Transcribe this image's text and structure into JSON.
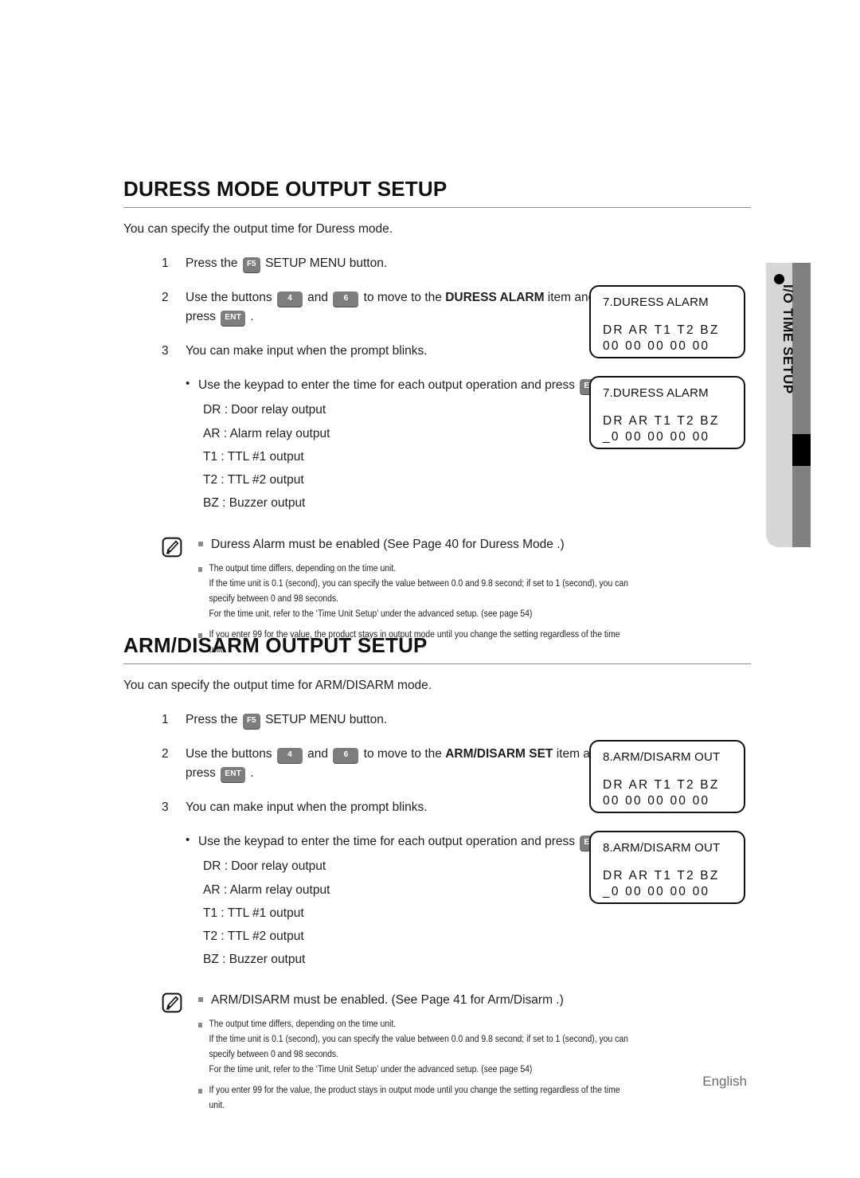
{
  "side_tab": {
    "label": "I/O TIME SETUP",
    "dot_icon": "bullet-dot-icon",
    "colors": {
      "light": "#d6d6d6",
      "dark": "#808080",
      "marker": "#000000"
    }
  },
  "sections": [
    {
      "id": "duress",
      "title": "DURESS MODE OUTPUT SETUP",
      "intro": "You can specify the output time for Duress mode.",
      "steps": [
        {
          "num": "1",
          "parts": [
            {
              "type": "text",
              "value": "Press the "
            },
            {
              "type": "key",
              "value": "F5"
            },
            {
              "type": "text",
              "value": " SETUP MENU button."
            }
          ]
        },
        {
          "num": "2",
          "parts": [
            {
              "type": "text",
              "value": "Use the buttons "
            },
            {
              "type": "key",
              "value": "4"
            },
            {
              "type": "text",
              "value": " and "
            },
            {
              "type": "key",
              "value": "6"
            },
            {
              "type": "text",
              "value": " to move to the "
            },
            {
              "type": "bold",
              "value": "DURESS ALARM"
            },
            {
              "type": "text",
              "value": " item and press "
            },
            {
              "type": "key",
              "value": "ENT"
            },
            {
              "type": "text",
              "value": " ."
            }
          ]
        },
        {
          "num": "3",
          "parts": [
            {
              "type": "text",
              "value": "You can make input when the prompt blinks."
            }
          ]
        }
      ],
      "sub_list": {
        "lead_parts": [
          {
            "type": "text",
            "value": "Use the keypad to enter the time for each output operation and press "
          },
          {
            "type": "key",
            "value": "ENT"
          },
          {
            "type": "text",
            "value": " ."
          }
        ],
        "items": [
          "DR : Door relay output",
          "AR : Alarm relay output",
          "T1 : TTL #1 output",
          "T2 : TTL #2 output",
          "BZ : Buzzer output"
        ]
      },
      "note": {
        "icon": "memo-note-icon",
        "first": "Duress Alarm must be enabled (See Page 40 for  Duress Mode .)",
        "second": [
          "The output time differs, depending on the time unit.",
          "If the time unit is 0.1 (second), you can specify the value between 0.0 and 9.8 second; if set to 1 (second), you can",
          "specify between 0 and 98 seconds.",
          "For the time unit, refer to the ‘Time Unit Setup’ under the advanced setup. (see page 54)"
        ],
        "third": [
          "If you enter 99 for the value, the product stays in output mode until you change the setting regardless of the time",
          "unit."
        ]
      },
      "lcds": [
        {
          "title": "7.DURESS ALARM",
          "row1": "DR AR T1 T2 BZ",
          "row2": "00 00 00 00 00"
        },
        {
          "title": "7.DURESS ALARM",
          "row1": "DR AR T1 T2 BZ",
          "row2": "_0 00 00 00 00"
        }
      ]
    },
    {
      "id": "armdisarm",
      "title": "ARM/DISARM OUTPUT SETUP",
      "intro": "You can specify the output time for ARM/DISARM mode.",
      "steps": [
        {
          "num": "1",
          "parts": [
            {
              "type": "text",
              "value": "Press the "
            },
            {
              "type": "key",
              "value": "F5"
            },
            {
              "type": "text",
              "value": " SETUP MENU button."
            }
          ]
        },
        {
          "num": "2",
          "parts": [
            {
              "type": "text",
              "value": "Use the buttons "
            },
            {
              "type": "key",
              "value": "4"
            },
            {
              "type": "text",
              "value": " and "
            },
            {
              "type": "key",
              "value": "6"
            },
            {
              "type": "text",
              "value": " to move to the "
            },
            {
              "type": "bold",
              "value": "ARM/DISARM SET"
            },
            {
              "type": "text",
              "value": " item and press "
            },
            {
              "type": "key",
              "value": "ENT"
            },
            {
              "type": "text",
              "value": " ."
            }
          ]
        },
        {
          "num": "3",
          "parts": [
            {
              "type": "text",
              "value": "You can make input when the prompt blinks."
            }
          ]
        }
      ],
      "sub_list": {
        "lead_parts": [
          {
            "type": "text",
            "value": "Use the keypad to enter the time for each output operation and press "
          },
          {
            "type": "key",
            "value": "ENT"
          },
          {
            "type": "text",
            "value": " ."
          }
        ],
        "items": [
          "DR : Door relay output",
          "AR : Alarm relay output",
          "T1 : TTL #1 output",
          "T2 : TTL #2 output",
          "BZ : Buzzer output"
        ]
      },
      "note": {
        "icon": "memo-note-icon",
        "first": "ARM/DISARM must be enabled. (See Page 41 for  Arm/Disarm .)",
        "second": [
          "The output time differs, depending on the time unit.",
          "If the time unit is 0.1 (second), you can specify the value between 0.0 and 9.8 second; if set to 1 (second), you can",
          "specify between 0 and 98 seconds.",
          "For the time unit, refer to the ‘Time Unit Setup’ under the advanced setup. (see page 54)"
        ],
        "third": [
          "If you enter 99 for the value, the product stays in output mode until you change the setting regardless of the time",
          "unit."
        ]
      },
      "lcds": [
        {
          "title": "8.ARM/DISARM OUT",
          "row1": "DR AR T1 T2 BZ",
          "row2": "00 00 00 00 00"
        },
        {
          "title": "8.ARM/DISARM OUT",
          "row1": "DR AR T1 T2 BZ",
          "row2": "_0 00 00 00 00"
        }
      ]
    }
  ],
  "footer": {
    "language": "English"
  }
}
